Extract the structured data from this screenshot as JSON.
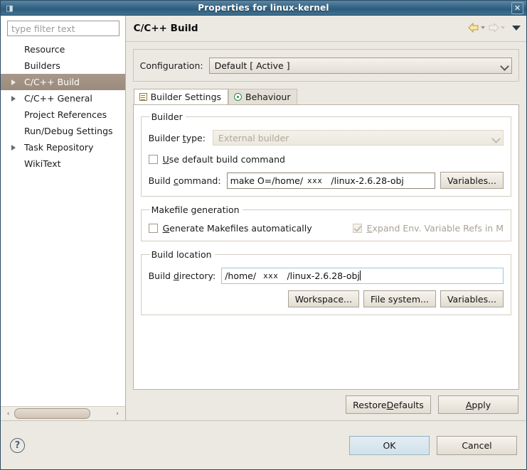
{
  "window": {
    "title": "Properties for linux-kernel",
    "close_label": "✕",
    "icon": "window-icon"
  },
  "sidebar": {
    "filter": {
      "placeholder": "type filter text",
      "value": ""
    },
    "items": [
      {
        "label": "Resource",
        "expandable": false,
        "selected": false
      },
      {
        "label": "Builders",
        "expandable": false,
        "selected": false
      },
      {
        "label": "C/C++ Build",
        "expandable": true,
        "selected": true
      },
      {
        "label": "C/C++ General",
        "expandable": true,
        "selected": false
      },
      {
        "label": "Project References",
        "expandable": false,
        "selected": false
      },
      {
        "label": "Run/Debug Settings",
        "expandable": false,
        "selected": false
      },
      {
        "label": "Task Repository",
        "expandable": true,
        "selected": false
      },
      {
        "label": "WikiText",
        "expandable": false,
        "selected": false
      }
    ],
    "scroll_left": "‹",
    "scroll_right": "›"
  },
  "page": {
    "title": "C/C++ Build",
    "nav": {
      "back": "back-arrow",
      "forward": "forward-arrow",
      "menu": "view-menu"
    }
  },
  "configuration": {
    "label": "Configuration:",
    "selected": "Default  [ Active ]"
  },
  "tabs": [
    {
      "label": "Builder Settings",
      "icon": "list-icon",
      "active": true
    },
    {
      "label": "Behaviour",
      "icon": "radio-icon",
      "active": false
    }
  ],
  "builder_group": {
    "legend": "Builder",
    "builder_type": {
      "label_pre": "Builder ",
      "label_mn": "t",
      "label_post": "ype:",
      "value": "External builder",
      "enabled": false
    },
    "use_default": {
      "label_pre": "",
      "label_mn": "U",
      "label_post": "se default build command",
      "checked": false
    },
    "build_command": {
      "label_pre": "Build ",
      "label_mn": "c",
      "label_post": "ommand:",
      "value_pre": "make O=/home/",
      "value_user": "xxx",
      "value_post": "/linux-2.6.28-obj",
      "button": "Variables..."
    }
  },
  "makefile_group": {
    "legend": "Makefile generation",
    "generate": {
      "label_pre": "",
      "label_mn": "G",
      "label_post": "enerate Makefiles automatically",
      "checked": false
    },
    "expand_env": {
      "label_pre": "",
      "label_mn": "E",
      "label_post": "xpand Env. Variable Refs in M",
      "checked": true,
      "enabled": false
    }
  },
  "location_group": {
    "legend": "Build location",
    "build_directory": {
      "label_pre": "Build ",
      "label_mn": "d",
      "label_post": "irectory:",
      "value_pre": "/home/",
      "value_user": "xxx",
      "value_post": "/linux-2.6.28-obj",
      "focused": true
    },
    "buttons": [
      "Workspace...",
      "File system...",
      "Variables..."
    ]
  },
  "page_actions": {
    "restore_pre": "Restore ",
    "restore_mn": "D",
    "restore_post": "efaults",
    "apply_pre": "",
    "apply_mn": "A",
    "apply_post": "pply"
  },
  "footer": {
    "help": "?",
    "ok": "OK",
    "cancel": "Cancel"
  },
  "colors": {
    "titlebar": "#3d6c8d",
    "selection": "#a8988a",
    "panel_bg": "#ece9e2",
    "default_button": "#cfe0e9"
  }
}
